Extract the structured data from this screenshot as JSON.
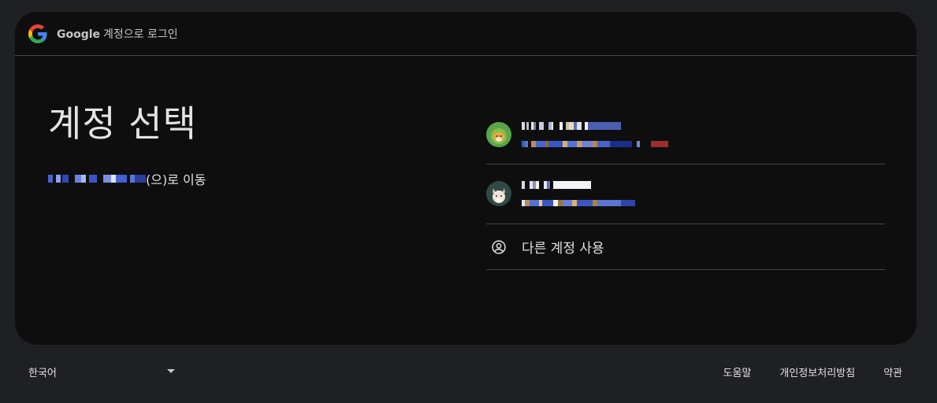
{
  "header": {
    "brand": "Google",
    "title": "계정으로 로그인"
  },
  "main": {
    "title": "계정 선택",
    "continue_suffix": "(으)로 이동"
  },
  "accounts": [
    {
      "avatar": "fox-avatar"
    },
    {
      "avatar": "cat-avatar"
    }
  ],
  "use_another": {
    "label": "다른 계정 사용",
    "icon": "account-circle-icon"
  },
  "footer": {
    "language": "한국어",
    "links": [
      "도움말",
      "개인정보처리방침",
      "약관"
    ]
  },
  "colors": {
    "page_bg": "#1f2023",
    "card_bg": "#0e0e0e",
    "divider": "#444746",
    "text": "#e3e3e3"
  }
}
